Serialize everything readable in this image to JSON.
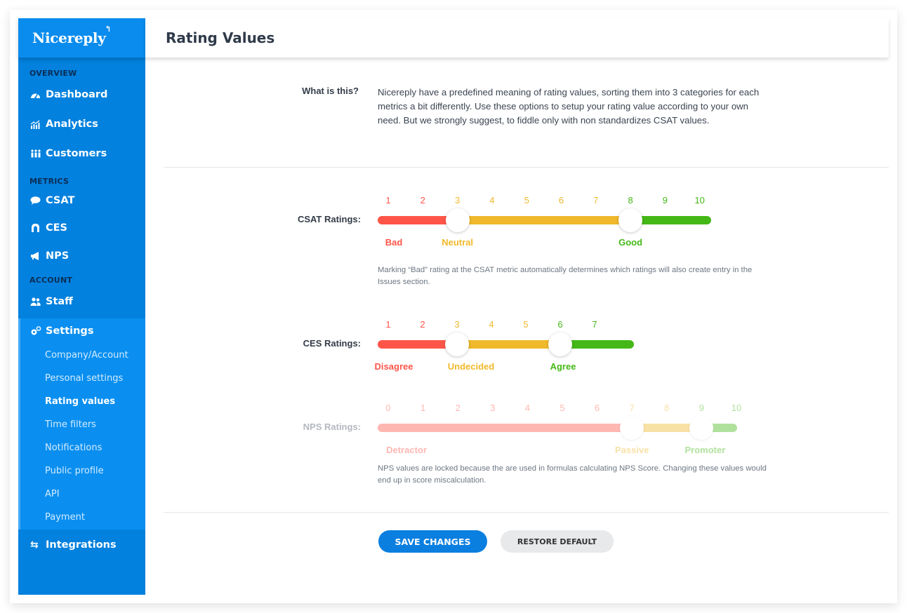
{
  "app": {
    "brand": "Nicereply"
  },
  "sidebar": {
    "sections": {
      "overview": "OVERVIEW",
      "metrics": "METRICS",
      "account": "ACCOUNT"
    },
    "items": {
      "dashboard": {
        "label": "Dashboard",
        "icon": "dashboard-gauge-icon"
      },
      "analytics": {
        "label": "Analytics",
        "icon": "analytics-chart-icon"
      },
      "customers": {
        "label": "Customers",
        "icon": "customers-group-icon"
      },
      "csat": {
        "label": "CSAT",
        "icon": "speech-bubble-icon"
      },
      "ces": {
        "label": "CES",
        "icon": "ces-icon"
      },
      "nps": {
        "label": "NPS",
        "icon": "megaphone-icon"
      },
      "staff": {
        "label": "Staff",
        "icon": "staff-users-icon"
      },
      "settings": {
        "label": "Settings",
        "icon": "gears-icon"
      },
      "integrations": {
        "label": "Integrations",
        "icon": "exchange-arrows-icon"
      }
    },
    "settings_sub": [
      {
        "label": "Company/Account",
        "active": false
      },
      {
        "label": "Personal settings",
        "active": false
      },
      {
        "label": "Rating values",
        "active": true
      },
      {
        "label": "Time filters",
        "active": false
      },
      {
        "label": "Notifications",
        "active": false
      },
      {
        "label": "Public profile",
        "active": false
      },
      {
        "label": "API",
        "active": false
      },
      {
        "label": "Payment",
        "active": false
      }
    ]
  },
  "header": {
    "title": "Rating Values"
  },
  "info": {
    "label": "What is this?",
    "text": "Nicereply have a predefined meaning of rating values, sorting them into 3 categories for each metrics a bit differently. Use these options to setup your rating value according to your own need.  But we strongly suggest, to fiddle only with non standardizes CSAT values."
  },
  "colors": {
    "bad": "#ff5549",
    "neutral": "#f0b92c",
    "good": "#44b816",
    "brand": "#0281de"
  },
  "ratings": {
    "csat": {
      "label": "CSAT Ratings:",
      "scale": [
        "1",
        "2",
        "3",
        "4",
        "5",
        "6",
        "7",
        "8",
        "9",
        "10"
      ],
      "thresholds": [
        3,
        8
      ],
      "categories": [
        "Bad",
        "Neutral",
        "Good"
      ],
      "locked": false,
      "note": "Marking “Bad” rating at the CSAT metric automatically determines which ratings will also create entry in the Issues section."
    },
    "ces": {
      "label": "CES Ratings:",
      "scale": [
        "1",
        "2",
        "3",
        "4",
        "5",
        "6",
        "7"
      ],
      "thresholds": [
        3,
        6
      ],
      "categories": [
        "Disagree",
        "Undecided",
        "Agree"
      ],
      "locked": false
    },
    "nps": {
      "label": "NPS Ratings:",
      "scale": [
        "0",
        "1",
        "2",
        "3",
        "4",
        "5",
        "6",
        "7",
        "8",
        "9",
        "10"
      ],
      "thresholds": [
        7,
        9
      ],
      "categories": [
        "Detractor",
        "Passive",
        "Promoter"
      ],
      "locked": true,
      "note": "NPS values are locked because the are used in formulas calculating NPS Score. Changing these values would end up in score miscalculation."
    }
  },
  "actions": {
    "save": "SAVE CHANGES",
    "restore": "RESTORE DEFAULT"
  }
}
